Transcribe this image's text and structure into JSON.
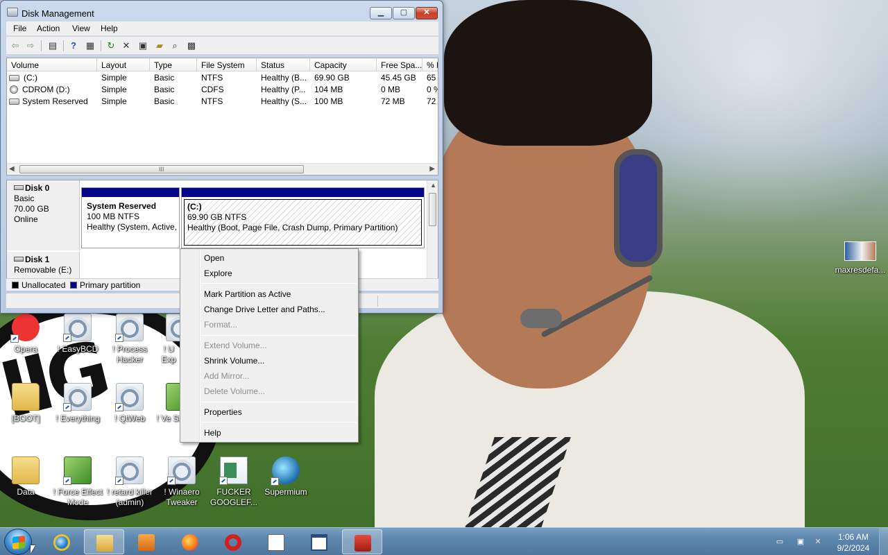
{
  "window": {
    "title": "Disk Management",
    "menu": [
      "File",
      "Action",
      "View",
      "Help"
    ],
    "toolbar_icons": [
      "back-icon",
      "forward-icon",
      "up-icon",
      "help-icon",
      "console-icon",
      "refresh-icon",
      "delete-icon",
      "properties-icon",
      "open-icon",
      "search-icon",
      "settings-icon"
    ],
    "controls": {
      "minimize": "▁",
      "maximize": "▢",
      "close": "✕"
    }
  },
  "volume_list": {
    "columns": [
      "Volume",
      "Layout",
      "Type",
      "File System",
      "Status",
      "Capacity",
      "Free Spa...",
      "% F"
    ],
    "rows": [
      {
        "volume": "(C:)",
        "layout": "Simple",
        "type": "Basic",
        "fs": "NTFS",
        "status": "Healthy (B...",
        "capacity": "69.90 GB",
        "free": "45.45 GB",
        "pct": "65"
      },
      {
        "volume": "CDROM (D:)",
        "layout": "Simple",
        "type": "Basic",
        "fs": "CDFS",
        "status": "Healthy (P...",
        "capacity": "104 MB",
        "free": "0 MB",
        "pct": "0 %"
      },
      {
        "volume": "System Reserved",
        "layout": "Simple",
        "type": "Basic",
        "fs": "NTFS",
        "status": "Healthy (S...",
        "capacity": "100 MB",
        "free": "72 MB",
        "pct": "72"
      }
    ],
    "scroll_grip": "III"
  },
  "disks": {
    "disk0": {
      "name": "Disk 0",
      "type": "Basic",
      "size": "70.00 GB",
      "state": "Online"
    },
    "disk1": {
      "name": "Disk 1",
      "type": "Removable (E:)"
    },
    "partitions": {
      "reserved": {
        "name": "System Reserved",
        "size": "100 MB NTFS",
        "status": "Healthy (System, Active,"
      },
      "c": {
        "name": "(C:)",
        "size": "69.90 GB NTFS",
        "status": "Healthy (Boot, Page File, Crash Dump, Primary Partition)"
      }
    },
    "legend": {
      "unallocated": "Unallocated",
      "primary": "Primary partition"
    }
  },
  "context_menu": {
    "open": "Open",
    "explore": "Explore",
    "mark_active": "Mark Partition as Active",
    "change_letter": "Change Drive Letter and Paths...",
    "format": "Format...",
    "extend": "Extend Volume...",
    "shrink": "Shrink Volume...",
    "add_mirror": "Add Mirror...",
    "delete": "Delete Volume...",
    "properties": "Properties",
    "help": "Help"
  },
  "desktop_icons": {
    "opera": "Opera",
    "easybcd": "! EasyBCD",
    "process_hacker": "! Process Hacker",
    "u_exp": "! U Exp",
    "boot": "[BOOT]",
    "everything": "! Everything",
    "qtweb": "! QtWeb",
    "ve_st": "! Ve St",
    "data": "Data",
    "force_effect": "! Force Effect Mode",
    "retard_killer": "! retard killer (admin)",
    "winaero": "! Winaero Tweaker",
    "fucker": "FUCKER GOOGLEF...",
    "supermium": "Supermium",
    "maxres": "maxresdefa..."
  },
  "taskbar": {
    "time": "1:06 AM",
    "date": "9/2/2024"
  }
}
